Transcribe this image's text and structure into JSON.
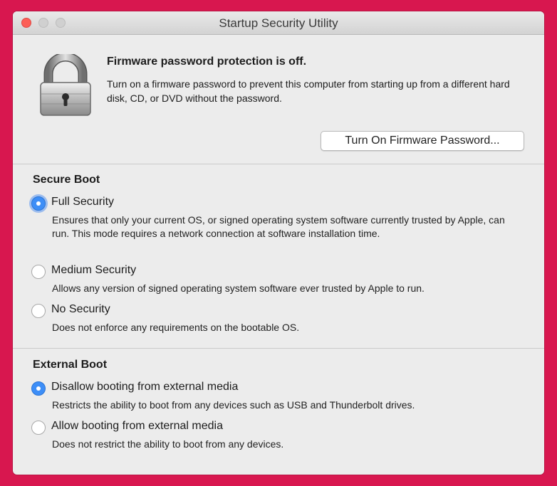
{
  "window": {
    "title": "Startup Security Utility"
  },
  "firmware": {
    "heading": "Firmware password protection is off.",
    "description": "Turn on a firmware password to prevent this computer from starting up from a different hard disk, CD, or DVD without the password.",
    "button_label": "Turn On Firmware Password..."
  },
  "secure_boot": {
    "title": "Secure Boot",
    "options": [
      {
        "label": "Full Security",
        "description": "Ensures that only your current OS, or signed operating system software currently trusted by Apple, can run. This mode requires a network connection at software installation time.",
        "selected": true
      },
      {
        "label": "Medium Security",
        "description": "Allows any version of signed operating system software ever trusted by Apple to run.",
        "selected": false
      },
      {
        "label": "No Security",
        "description": "Does not enforce any requirements on the bootable OS.",
        "selected": false
      }
    ]
  },
  "external_boot": {
    "title": "External Boot",
    "options": [
      {
        "label": "Disallow booting from external media",
        "description": "Restricts the ability to boot from any devices such as USB and Thunderbolt drives.",
        "selected": true
      },
      {
        "label": "Allow booting from external media",
        "description": "Does not restrict the ability to boot from any devices.",
        "selected": false
      }
    ]
  },
  "colors": {
    "background": "#d8174f",
    "radio_selected": "#3d8ef7",
    "close_button": "#fc5f57"
  },
  "icons": [
    "close-icon",
    "minimize-icon",
    "zoom-icon",
    "lock-icon"
  ]
}
